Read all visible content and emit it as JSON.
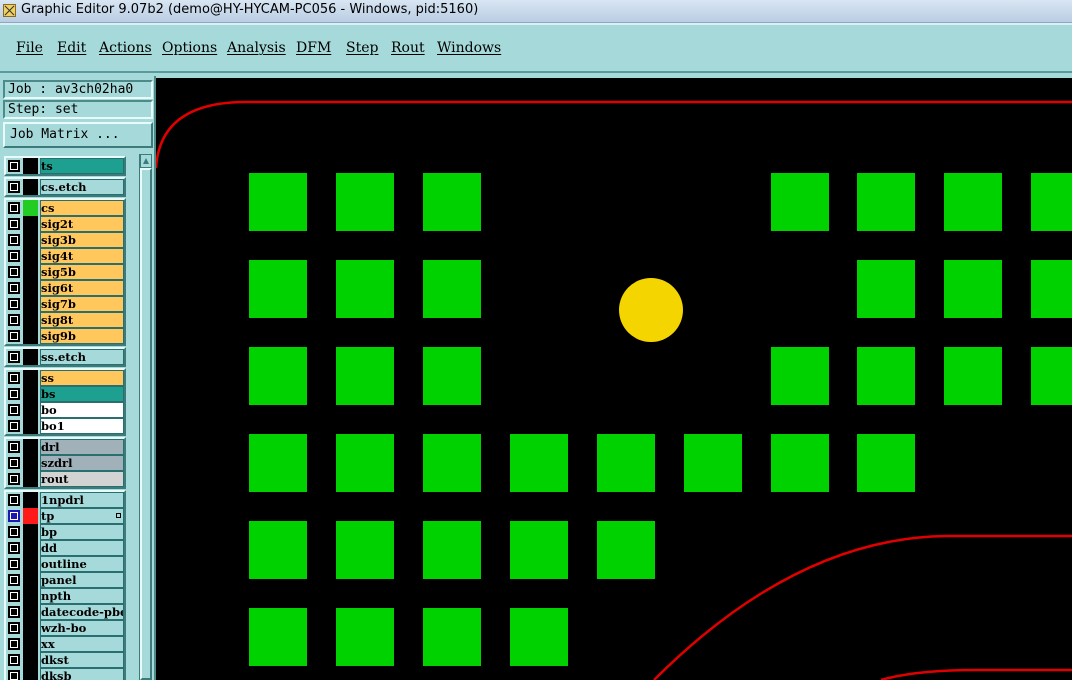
{
  "window": {
    "title": "Graphic Editor 9.07b2 (demo@HY-HYCAM-PC056 - Windows, pid:5160)"
  },
  "menu": [
    "File",
    "Edit",
    "Actions",
    "Options",
    "Analysis",
    "DFM",
    "Step",
    "Rout",
    "Windows"
  ],
  "job": {
    "label": "Job : av3ch02ha0",
    "step": "Step: set",
    "matrix_button": "Job Matrix ..."
  },
  "layers": [
    [
      {
        "name": "ts",
        "color": "sel",
        "swatch": "#000000"
      }
    ],
    [
      {
        "name": "cs.etch",
        "color": "teal",
        "swatch": "#000000"
      }
    ],
    [
      {
        "name": "cs",
        "color": "orange",
        "swatch": "#22cc22"
      },
      {
        "name": "sig2t",
        "color": "orange",
        "swatch": "#000000"
      },
      {
        "name": "sig3b",
        "color": "orange",
        "swatch": "#000000"
      },
      {
        "name": "sig4t",
        "color": "orange",
        "swatch": "#000000"
      },
      {
        "name": "sig5b",
        "color": "orange",
        "swatch": "#000000"
      },
      {
        "name": "sig6t",
        "color": "orange",
        "swatch": "#000000"
      },
      {
        "name": "sig7b",
        "color": "orange",
        "swatch": "#000000"
      },
      {
        "name": "sig8t",
        "color": "orange",
        "swatch": "#000000"
      },
      {
        "name": "sig9b",
        "color": "orange",
        "swatch": "#000000"
      }
    ],
    [
      {
        "name": "ss.etch",
        "color": "teal",
        "swatch": "#000000"
      }
    ],
    [
      {
        "name": "ss",
        "color": "orange",
        "swatch": "#000000"
      },
      {
        "name": "bs",
        "color": "sel",
        "swatch": "#000000"
      },
      {
        "name": "bo",
        "color": "white",
        "swatch": "#000000"
      },
      {
        "name": "bo1",
        "color": "white",
        "swatch": "#000000"
      }
    ],
    [
      {
        "name": "drl",
        "color": "grey",
        "swatch": "#000000"
      },
      {
        "name": "szdrl",
        "color": "grey",
        "swatch": "#000000"
      },
      {
        "name": "rout",
        "color": "lgrey",
        "swatch": "#000000"
      }
    ],
    [
      {
        "name": "1npdrl",
        "color": "teal",
        "swatch": "#000000"
      },
      {
        "name": "tp",
        "color": "teal",
        "swatch": "#ff1a1a",
        "active": true
      },
      {
        "name": "bp",
        "color": "teal",
        "swatch": "#000000"
      },
      {
        "name": "dd",
        "color": "teal",
        "swatch": "#000000"
      },
      {
        "name": "outline",
        "color": "teal",
        "swatch": "#000000"
      },
      {
        "name": "panel",
        "color": "teal",
        "swatch": "#000000"
      },
      {
        "name": "npth",
        "color": "teal",
        "swatch": "#000000"
      },
      {
        "name": "datecode-pbe",
        "color": "teal",
        "swatch": "#000000"
      },
      {
        "name": "wzh-bo",
        "color": "teal",
        "swatch": "#000000"
      },
      {
        "name": "xx",
        "color": "teal",
        "swatch": "#000000"
      },
      {
        "name": "dkst",
        "color": "teal",
        "swatch": "#000000"
      },
      {
        "name": "dksb",
        "color": "teal",
        "swatch": "#000000"
      }
    ]
  ],
  "colors": {
    "canvas_bg": "#000000",
    "pad": "#00d200",
    "circle_pad": "#f5d500",
    "profile_line": "#e00000",
    "panel_bg": "#a6d9d9"
  }
}
